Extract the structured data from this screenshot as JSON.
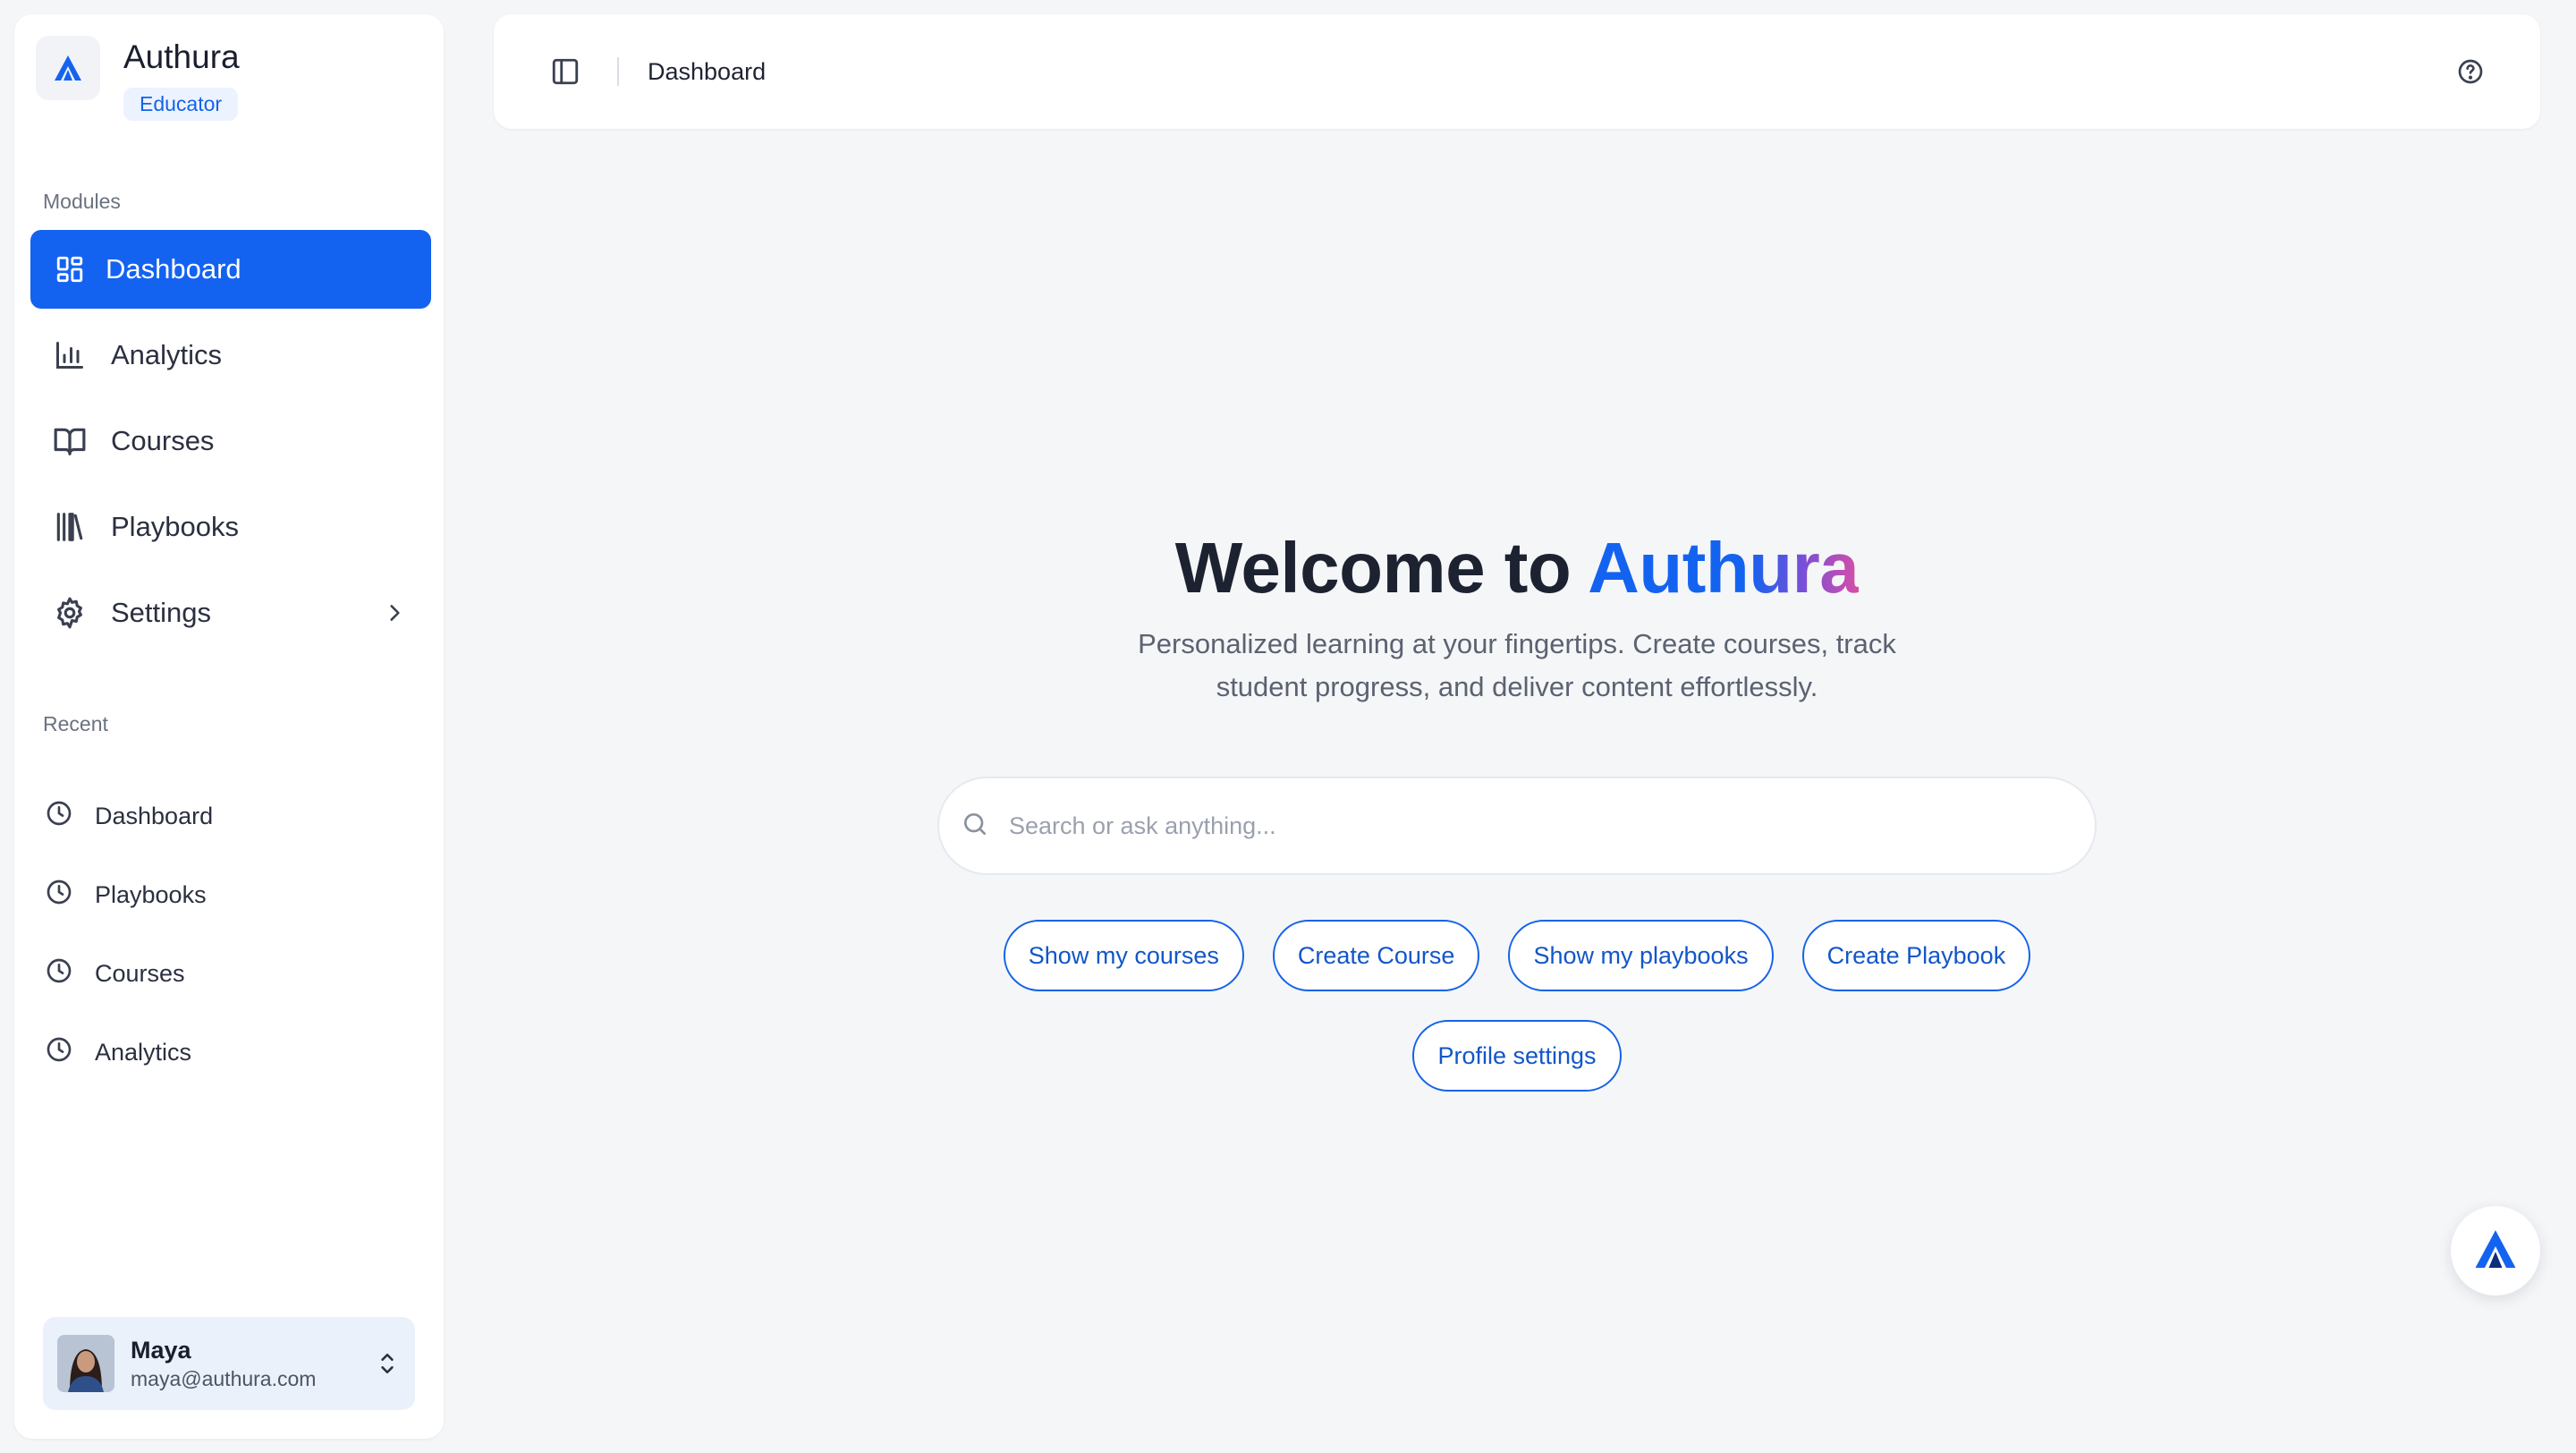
{
  "brand": {
    "name": "Authura",
    "role": "Educator"
  },
  "sidebar": {
    "modules_label": "Modules",
    "items": [
      {
        "label": "Dashboard",
        "icon": "dashboard-grid-icon",
        "active": true
      },
      {
        "label": "Analytics",
        "icon": "bar-chart-icon",
        "active": false
      },
      {
        "label": "Courses",
        "icon": "open-book-icon",
        "active": false
      },
      {
        "label": "Playbooks",
        "icon": "library-icon",
        "active": false
      },
      {
        "label": "Settings",
        "icon": "gear-icon",
        "active": false
      }
    ],
    "recent_label": "Recent",
    "recent": [
      {
        "label": "Dashboard"
      },
      {
        "label": "Playbooks"
      },
      {
        "label": "Courses"
      },
      {
        "label": "Analytics"
      }
    ]
  },
  "user": {
    "name": "Maya",
    "email": "maya@authura.com"
  },
  "topbar": {
    "title": "Dashboard"
  },
  "hero": {
    "title_prefix": "Welcome to ",
    "title_accent": "Authura",
    "subtitle": "Personalized learning at your fingertips. Create courses, track student progress, and deliver content effortlessly."
  },
  "search": {
    "placeholder": "Search or ask anything...",
    "value": ""
  },
  "quick_actions": {
    "show_courses": "Show my courses",
    "create_course": "Create Course",
    "show_playbooks": "Show my playbooks",
    "create_playbook": "Create Playbook",
    "profile_settings": "Profile settings"
  },
  "colors": {
    "accent": "#1463f0",
    "active_nav_bg": "#1463f0",
    "badge_bg": "#ecf3ff",
    "page_bg": "#f5f6f8"
  }
}
